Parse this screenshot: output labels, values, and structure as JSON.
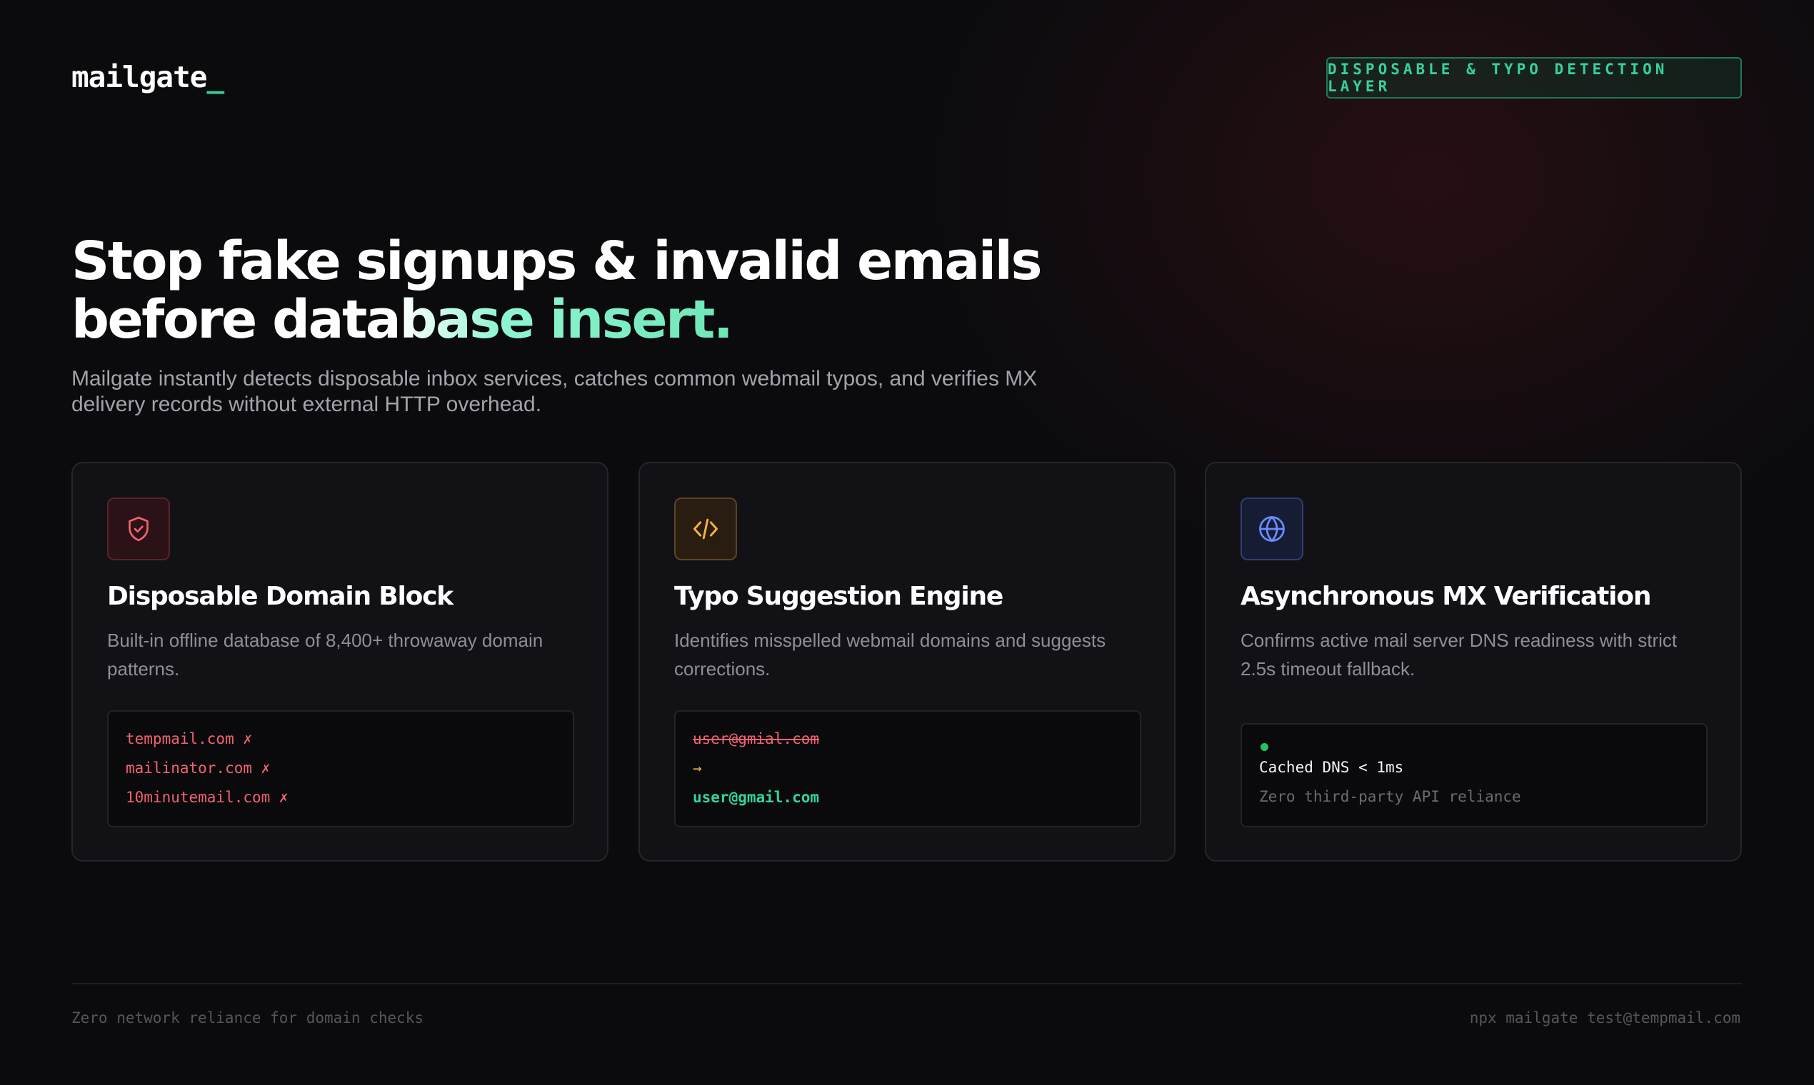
{
  "header": {
    "logo_text": "mailgate",
    "logo_cursor": "_",
    "badge": "DISPOSABLE & TYPO DETECTION LAYER"
  },
  "hero": {
    "headline_line1": "Stop fake signups & invalid emails",
    "headline_line2_plain": "before data",
    "headline_line2_accent": "base insert.",
    "subline": "Mailgate instantly detects disposable inbox services, catches common webmail typos, and verifies MX delivery records without external HTTP overhead."
  },
  "cards": [
    {
      "icon": "shield-check-icon",
      "title": "Disposable Domain Block",
      "description": "Built-in offline database of 8,400+ throwaway domain patterns.",
      "code_lines": [
        "tempmail.com ✗",
        "mailinator.com ✗",
        "10minutemail.com ✗"
      ]
    },
    {
      "icon": "code-icon",
      "title": "Typo Suggestion Engine",
      "description": "Identifies misspelled webmail domains and suggests corrections.",
      "code_wrong": "user@gmial.com",
      "code_arrow": "→",
      "code_right": "user@gmail.com"
    },
    {
      "icon": "globe-icon",
      "title": "Asynchronous MX Verification",
      "description": "Confirms active mail server DNS readiness with strict 2.5s timeout fallback.",
      "code_status": "Cached DNS < 1ms",
      "code_note": "Zero third-party API reliance"
    }
  ],
  "footer": {
    "left": "Zero network reliance for domain checks",
    "right": "npx mailgate test@tempmail.com"
  },
  "colors": {
    "accent_green": "#34d399",
    "error_red": "#f0636f",
    "warning_amber": "#f3b341",
    "info_blue": "#6b8cff",
    "background": "#0b0b0e"
  }
}
